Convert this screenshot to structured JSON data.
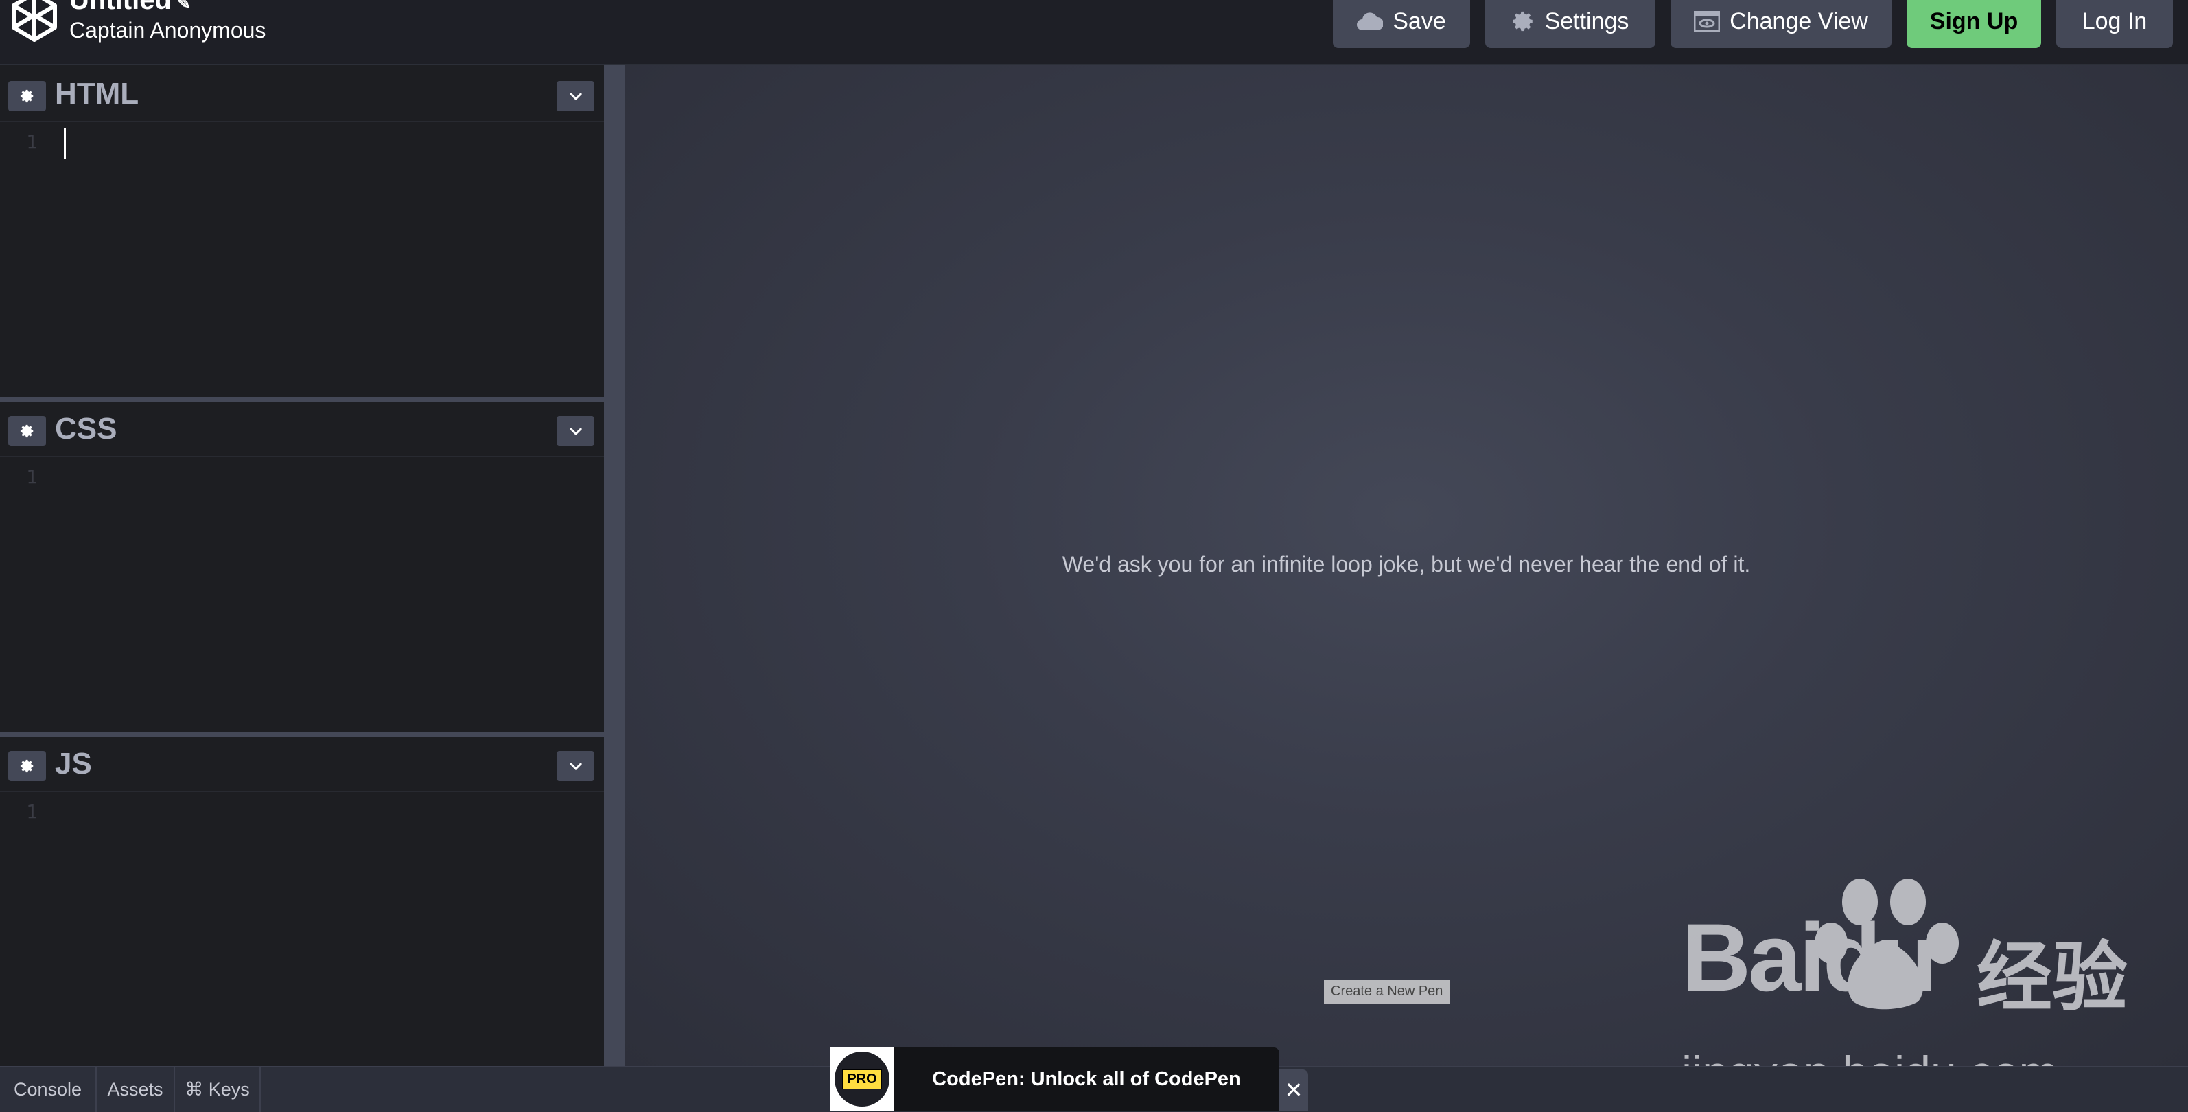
{
  "header": {
    "title": "Untitled",
    "edit_icon": "pencil-icon",
    "author": "Captain Anonymous",
    "buttons": {
      "save": "Save",
      "settings": "Settings",
      "change_view": "Change View",
      "sign_up": "Sign Up",
      "log_in": "Log In"
    }
  },
  "editors": [
    {
      "title": "HTML",
      "line": "1"
    },
    {
      "title": "CSS",
      "line": "1"
    },
    {
      "title": "JS",
      "line": "1"
    }
  ],
  "preview": {
    "message": "We'd ask you for an infinite loop joke, but we'd never hear the end of it.",
    "tooltip": "Create a New Pen"
  },
  "watermark": {
    "brand": "Baidu",
    "cn": "经验",
    "url": "jingyan.baidu.com"
  },
  "bottom_bar": {
    "tabs": [
      "Console",
      "Assets",
      "⌘ Keys"
    ]
  },
  "promo": {
    "badge": "PRO",
    "text": "CodePen: Unlock all of CodePen",
    "close": "✕"
  },
  "colors": {
    "header_bg": "#1e1f26",
    "button_bg": "#444857",
    "signup_bg": "#6fcb7b",
    "editor_bg": "#1d1e22"
  }
}
